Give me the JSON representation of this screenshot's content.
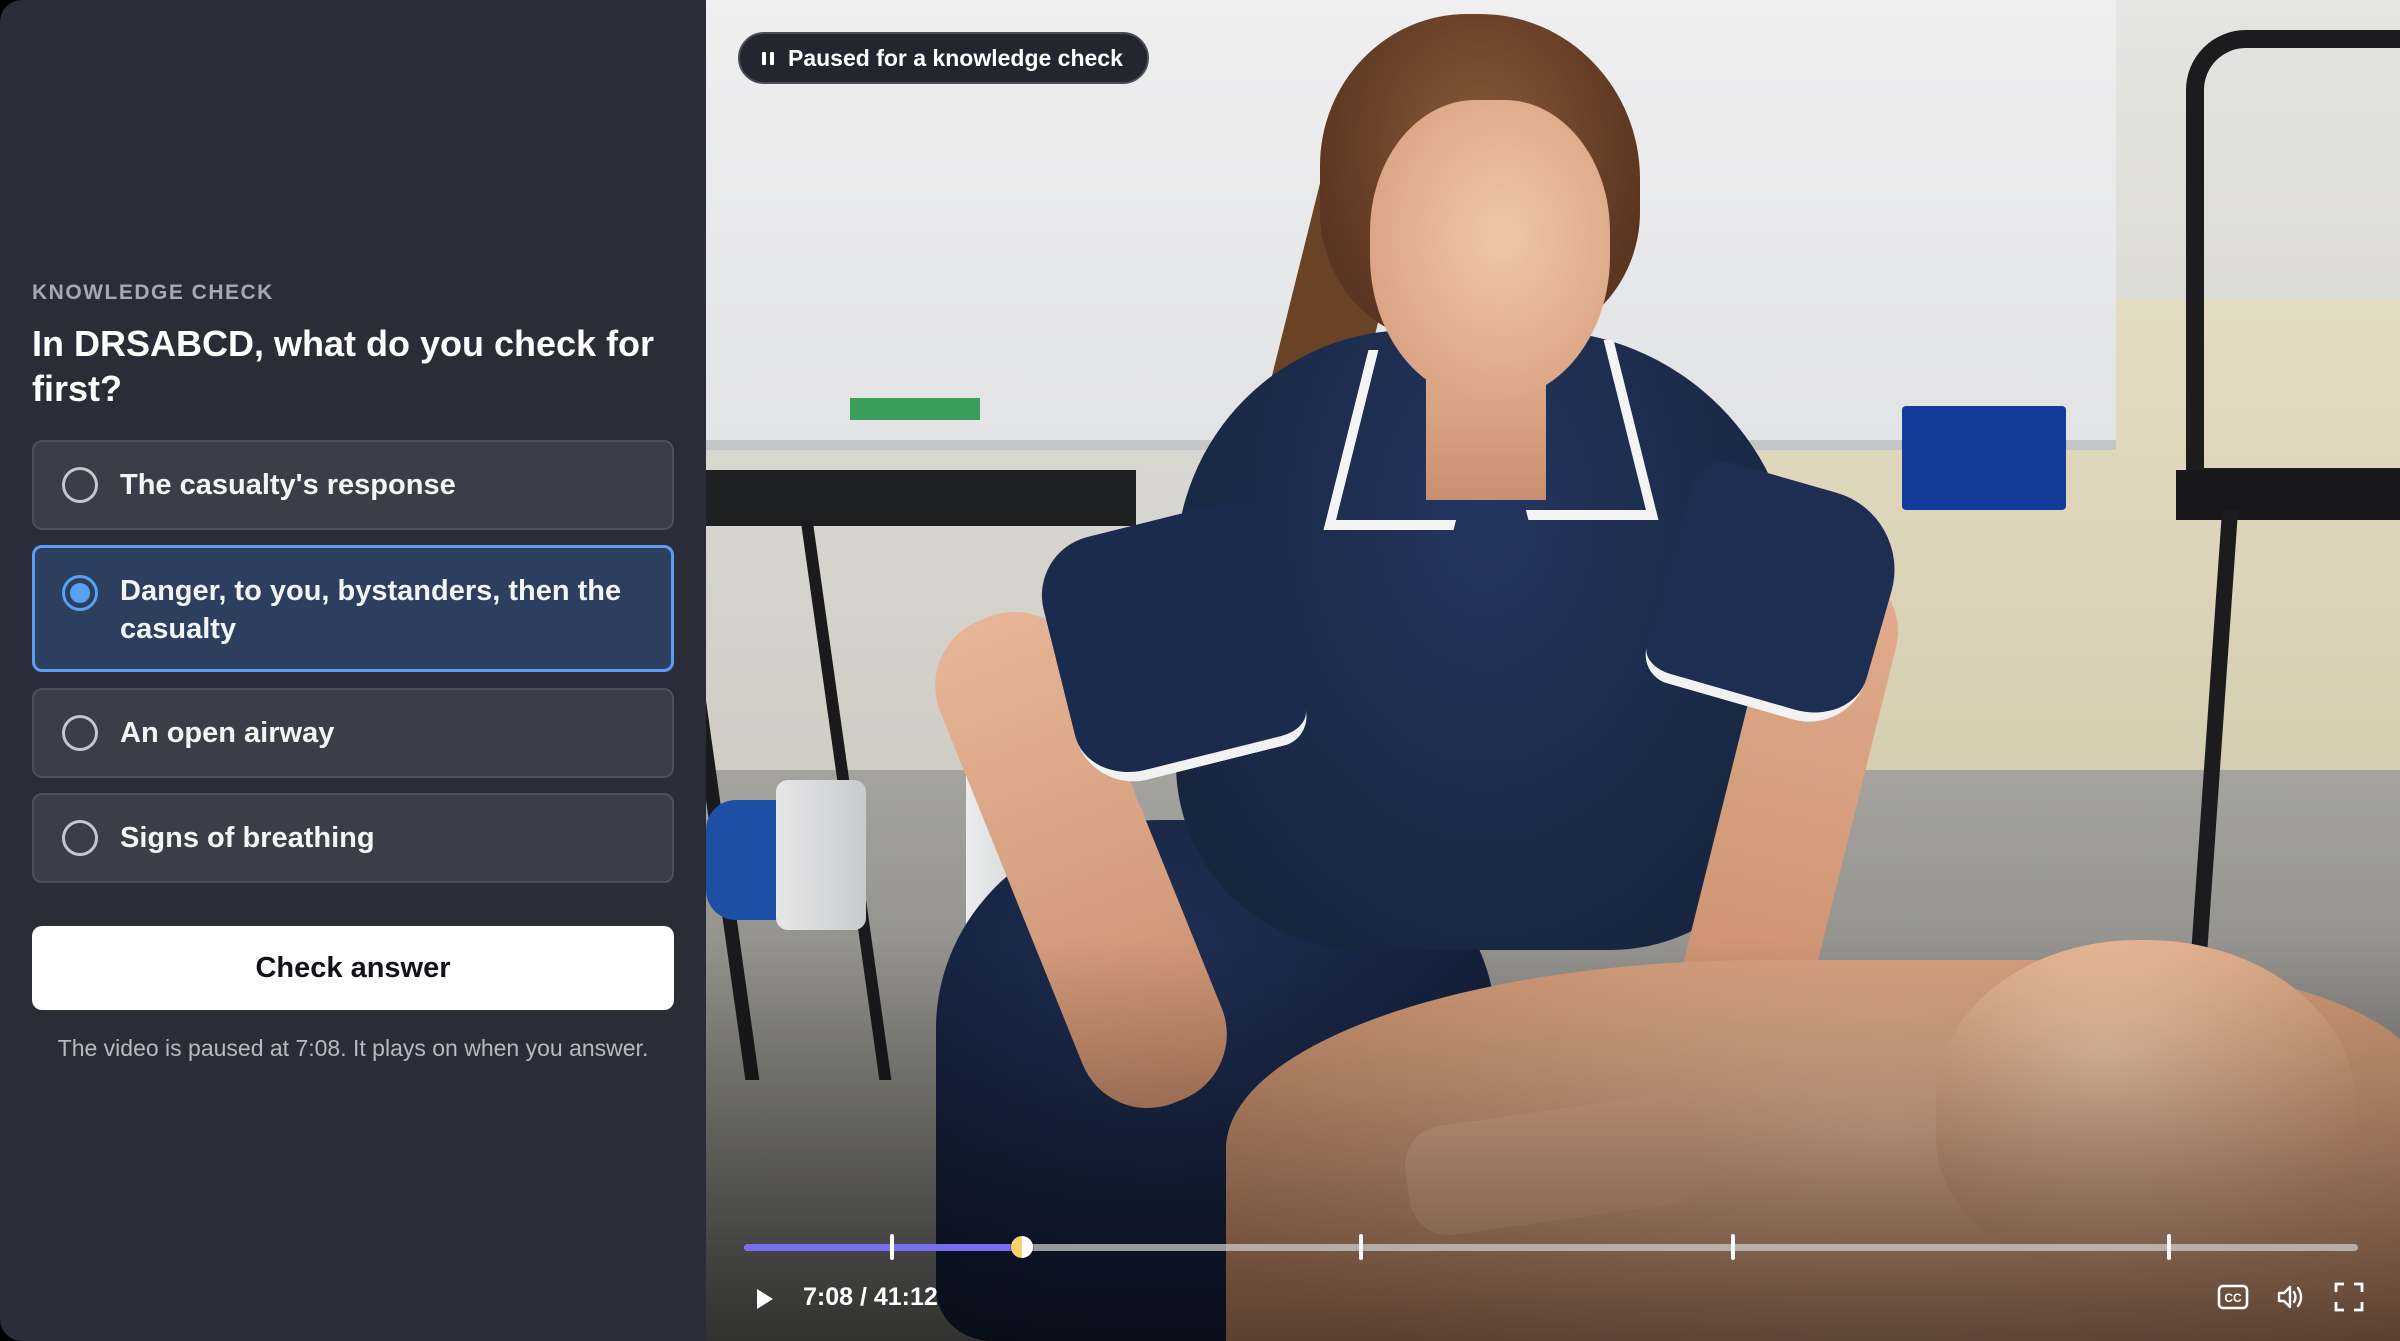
{
  "quiz": {
    "eyebrow": "KNOWLEDGE CHECK",
    "question": "In DRSABCD, what do you check for first?",
    "options": [
      {
        "label": "The casualty's response",
        "selected": false
      },
      {
        "label": "Danger, to you, bystanders, then the casualty",
        "selected": true
      },
      {
        "label": "An open airway",
        "selected": false
      },
      {
        "label": "Signs of breathing",
        "selected": false
      }
    ],
    "submit_label": "Check answer",
    "hint": "The video is paused at 7:08. It plays on when you answer."
  },
  "video": {
    "status_pill": "Paused for a knowledge check",
    "time_display": "7:08 / 41:12",
    "progress_fraction": 0.172,
    "chapter_marks": [
      0.092,
      0.382,
      0.613,
      0.883
    ],
    "icons": {
      "play": "play-icon",
      "captions": "cc-icon",
      "volume": "volume-icon",
      "fullscreen": "fullscreen-icon",
      "pause_status": "pause-icon"
    },
    "colors": {
      "progress": "#7a6ef0",
      "selected_accent": "#5b9df5"
    }
  }
}
